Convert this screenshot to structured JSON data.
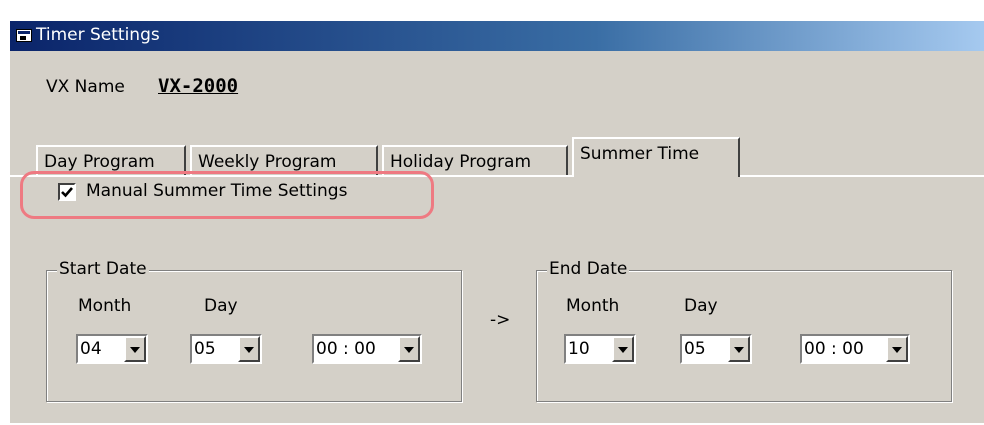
{
  "window": {
    "title": "Timer Settings"
  },
  "vx": {
    "label": "VX Name",
    "value": "VX-2000"
  },
  "tabs": [
    {
      "label": "Day Program"
    },
    {
      "label": "Weekly Program"
    },
    {
      "label": "Holiday Program"
    },
    {
      "label": "Summer Time",
      "active": true
    }
  ],
  "manual_checkbox": {
    "label": "Manual Summer Time Settings",
    "checked": true
  },
  "start": {
    "title": "Start Date",
    "month_label": "Month",
    "day_label": "Day",
    "month": "04",
    "day": "05",
    "time": "00 : 00"
  },
  "arrow_text": "->",
  "end": {
    "title": "End Date",
    "month_label": "Month",
    "day_label": "Day",
    "month": "10",
    "day": "05",
    "time": "00 : 00"
  },
  "colors": {
    "highlight": "#ee7a82",
    "title_bar": "#0a246a",
    "face": "#d4d0c8"
  }
}
